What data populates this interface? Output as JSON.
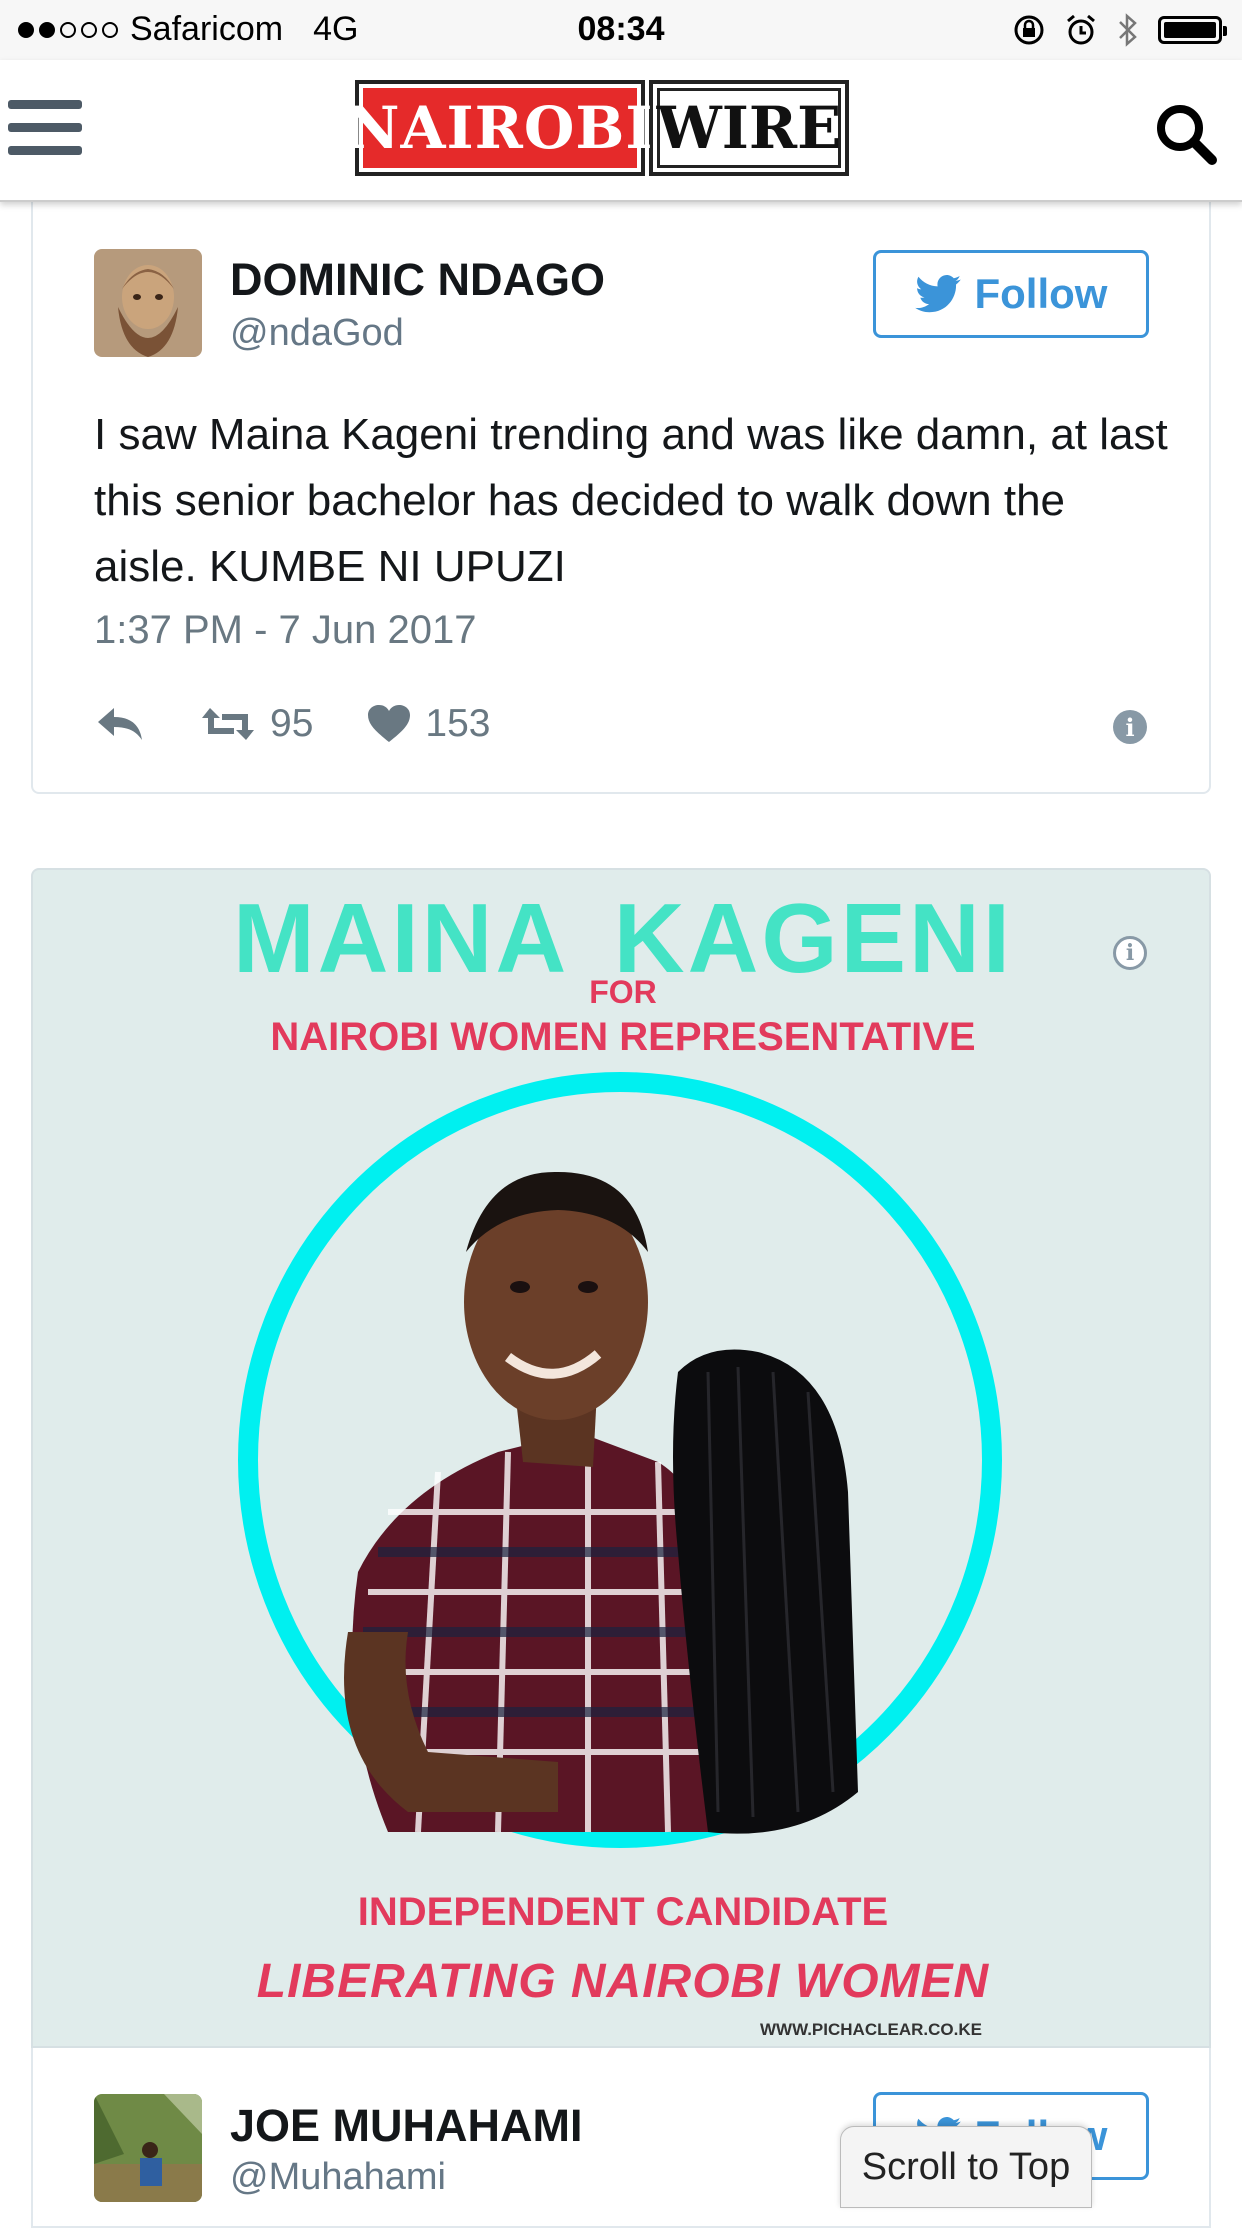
{
  "status_bar": {
    "carrier": "Safaricom",
    "network": "4G",
    "time": "08:34"
  },
  "header": {
    "logo_left": "NAIROBI",
    "logo_right": "WIRE"
  },
  "tweet": {
    "name": "DOMINIC NDAGO",
    "handle": "@ndaGod",
    "follow_label": "Follow",
    "text": "I saw Maina Kageni trending and was like damn, at last this senior bachelor has decided to walk down the aisle. KUMBE NI UPUZI",
    "timestamp": "1:37 PM - 7 Jun 2017",
    "retweets": "95",
    "likes": "153"
  },
  "poster": {
    "title": "MAINA  KAGENI",
    "for": "FOR",
    "subtitle": "NAIROBI WOMEN REPRESENTATIVE",
    "independent": "INDEPENDENT CANDIDATE",
    "slogan": "LIBERATING NAIROBI WOMEN",
    "website": "WWW.PICHACLEAR.CO.KE"
  },
  "tweet2": {
    "name": "JOE MUHAHAMI",
    "handle": "@Muhahami",
    "follow_label": "Follow"
  },
  "scroll_to_top": "Scroll to Top",
  "colors": {
    "twitter_blue": "#3b94d9",
    "poster_teal": "#44e3c5",
    "poster_red": "#e23a5c",
    "ring_cyan": "#00f0f0",
    "logo_red": "#e52a2a"
  }
}
